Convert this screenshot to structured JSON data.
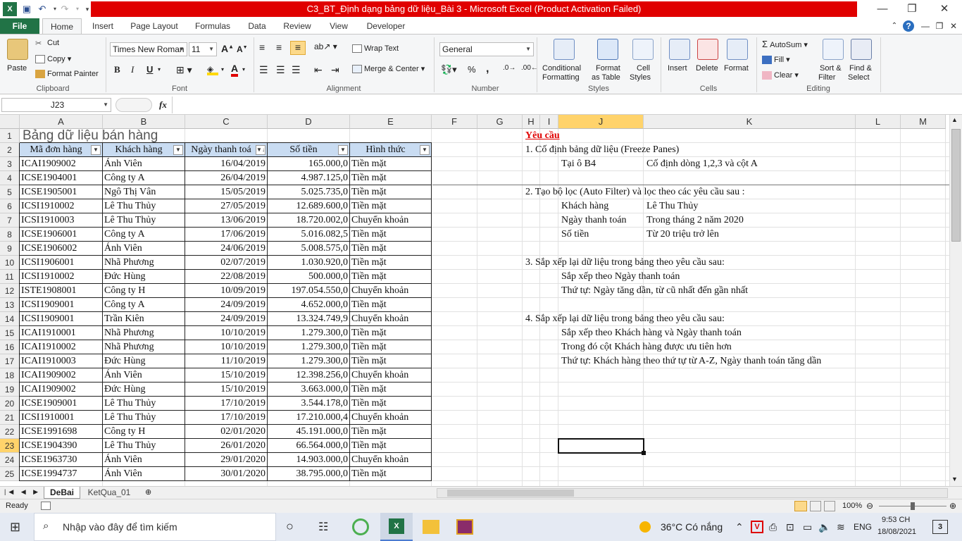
{
  "window": {
    "title": "C3_BT_Định dạng bảng dữ liệu_Bài 3  -  Microsoft Excel (Product Activation Failed)",
    "minimize": "—",
    "restore": "❐",
    "close": "✕"
  },
  "tabs": [
    "File",
    "Home",
    "Insert",
    "Page Layout",
    "Formulas",
    "Data",
    "Review",
    "View",
    "Developer"
  ],
  "ribbon": {
    "clipboard": {
      "paste": "Paste",
      "cut": "Cut",
      "copy": "Copy",
      "format_painter": "Format Painter",
      "label": "Clipboard"
    },
    "font": {
      "name": "Times New Roman",
      "size": "11",
      "bold": "B",
      "italic": "I",
      "underline": "U",
      "label": "Font"
    },
    "alignment": {
      "wrap": "Wrap Text",
      "merge": "Merge & Center",
      "label": "Alignment"
    },
    "number": {
      "format": "General",
      "percent": "%",
      "comma": ",",
      "label": "Number"
    },
    "styles": {
      "conditional": "Conditional",
      "conditional2": "Formatting",
      "format_table": "Format",
      "format_table2": "as Table",
      "cell_styles": "Cell",
      "cell_styles2": "Styles",
      "label": "Styles"
    },
    "cells": {
      "insert": "Insert",
      "delete": "Delete",
      "format": "Format",
      "label": "Cells"
    },
    "editing": {
      "autosum": "AutoSum",
      "fill": "Fill",
      "clear": "Clear",
      "sort": "Sort &",
      "sort2": "Filter",
      "find": "Find &",
      "find2": "Select",
      "label": "Editing"
    }
  },
  "formula_bar": {
    "name_box": "J23",
    "fx": "fx",
    "value": ""
  },
  "columns": [
    "A",
    "B",
    "C",
    "D",
    "E",
    "F",
    "G",
    "H",
    "I",
    "J",
    "K",
    "L",
    "M"
  ],
  "rows": [
    "1",
    "2",
    "3",
    "4",
    "5",
    "6",
    "7",
    "8",
    "9",
    "10",
    "11",
    "12",
    "13",
    "14",
    "15",
    "16",
    "17",
    "18",
    "19",
    "20",
    "21",
    "22",
    "23",
    "24",
    "25"
  ],
  "sheet_title": "Bảng dữ liệu bán hàng",
  "table_headers": [
    "Mã đơn hàng",
    "Khách hàng",
    "Ngày thanh toá",
    "Số tiền",
    "Hình thức"
  ],
  "table_rows": [
    [
      "ICAI1909002",
      "Ánh Viên",
      "16/04/2019",
      "165.000,0",
      "Tiền mặt"
    ],
    [
      "ICSE1904001",
      "Công ty A",
      "26/04/2019",
      "4.987.125,0",
      "Tiền mặt"
    ],
    [
      "ICSE1905001",
      "Ngô Thị Vân",
      "15/05/2019",
      "5.025.735,0",
      "Tiền mặt"
    ],
    [
      "ICSI1910002",
      "Lê Thu Thủy",
      "27/05/2019",
      "12.689.600,0",
      "Tiền mặt"
    ],
    [
      "ICSI1910003",
      "Lê Thu Thủy",
      "13/06/2019",
      "18.720.002,0",
      "Chuyển khoản"
    ],
    [
      "ICSE1906001",
      "Công ty A",
      "17/06/2019",
      "5.016.082,5",
      "Tiền mặt"
    ],
    [
      "ICSE1906002",
      "Ánh Viên",
      "24/06/2019",
      "5.008.575,0",
      "Tiền mặt"
    ],
    [
      "ICSI1906001",
      "Nhã Phương",
      "02/07/2019",
      "1.030.920,0",
      "Tiền mặt"
    ],
    [
      "ICSI1910002",
      "Đức Hùng",
      "22/08/2019",
      "500.000,0",
      "Tiền mặt"
    ],
    [
      "ISTE1908001",
      "Công ty H",
      "10/09/2019",
      "197.054.550,0",
      "Chuyển khoản"
    ],
    [
      "ICSI1909001",
      "Công ty A",
      "24/09/2019",
      "4.652.000,0",
      "Tiền mặt"
    ],
    [
      "ICSI1909001",
      "Trần Kiên",
      "24/09/2019",
      "13.324.749,9",
      "Chuyển khoản"
    ],
    [
      "ICAI1910001",
      "Nhã Phương",
      "10/10/2019",
      "1.279.300,0",
      "Tiền mặt"
    ],
    [
      "ICAI1910002",
      "Nhã Phương",
      "10/10/2019",
      "1.279.300,0",
      "Tiền mặt"
    ],
    [
      "ICAI1910003",
      "Đức Hùng",
      "11/10/2019",
      "1.279.300,0",
      "Tiền mặt"
    ],
    [
      "ICAI1909002",
      "Ánh Viên",
      "15/10/2019",
      "12.398.256,0",
      "Chuyển khoản"
    ],
    [
      "ICAI1909002",
      "Đức Hùng",
      "15/10/2019",
      "3.663.000,0",
      "Tiền mặt"
    ],
    [
      "ICSE1909001",
      "Lê Thu Thủy",
      "17/10/2019",
      "3.544.178,0",
      "Tiền mặt"
    ],
    [
      "ICSI1910001",
      "Lê Thu Thủy",
      "17/10/2019",
      "17.210.000,4",
      "Chuyển khoản"
    ],
    [
      "ICSE1991698",
      "Công ty H",
      "02/01/2020",
      "45.191.000,0",
      "Tiền mặt"
    ],
    [
      "ICSE1904390",
      "Lê Thu Thủy",
      "26/01/2020",
      "66.564.000,0",
      "Tiền mặt"
    ],
    [
      "ICSE1963730",
      "Ánh Viên",
      "29/01/2020",
      "14.903.000,0",
      "Chuyển khoản"
    ],
    [
      "ICSE1994737",
      "Ánh Viên",
      "30/01/2020",
      "38.795.000,0",
      "Tiền mặt"
    ]
  ],
  "requirements": {
    "heading": "Yêu cầu",
    "lines": [
      {
        "row": 2,
        "col": "H",
        "text": "1. Cố định bảng dữ liệu (Freeze Panes)"
      },
      {
        "row": 3,
        "col": "J",
        "text": "Tại ô B4"
      },
      {
        "row": 3,
        "col": "K",
        "text": "Cố định dòng 1,2,3 và cột A"
      },
      {
        "row": 5,
        "col": "H",
        "text": "2. Tạo bộ lọc (Auto Filter) và lọc theo các yêu cầu sau :"
      },
      {
        "row": 6,
        "col": "J",
        "text": "Khách hàng"
      },
      {
        "row": 6,
        "col": "K",
        "text": "Lê Thu Thủy"
      },
      {
        "row": 7,
        "col": "J",
        "text": "Ngày thanh toán"
      },
      {
        "row": 7,
        "col": "K",
        "text": "Trong tháng 2 năm 2020"
      },
      {
        "row": 8,
        "col": "J",
        "text": "Số tiền"
      },
      {
        "row": 8,
        "col": "K",
        "text": "Từ 20 triệu trở lên"
      },
      {
        "row": 10,
        "col": "H",
        "text": "3. Sắp xếp lại dữ liệu trong bảng theo yêu cầu sau:"
      },
      {
        "row": 11,
        "col": "J",
        "text": "Sắp xếp theo Ngày thanh toán"
      },
      {
        "row": 12,
        "col": "J",
        "text": "Thứ tự: Ngày tăng dần, từ cũ nhất đến gần nhất"
      },
      {
        "row": 14,
        "col": "H",
        "text": "4. Sắp xếp lại dữ liệu trong bảng theo yêu cầu sau:"
      },
      {
        "row": 15,
        "col": "J",
        "text": "Sắp xếp theo Khách hàng và Ngày thanh toán"
      },
      {
        "row": 16,
        "col": "J",
        "text": "Trong đó cột Khách hàng được ưu tiên hơn"
      },
      {
        "row": 17,
        "col": "J",
        "text": "Thứ tự: Khách hàng theo thứ tự từ A-Z, Ngày thanh toán tăng dần"
      }
    ]
  },
  "sheets": [
    "DeBai",
    "KetQua_01"
  ],
  "status": {
    "ready": "Ready",
    "zoom": "100%"
  },
  "taskbar": {
    "search_placeholder": "Nhập vào đây để tìm kiếm",
    "weather": "36°C  Có nắng",
    "lang": "ENG",
    "time": "9:53 CH",
    "date": "18/08/2021",
    "notifications": "3"
  },
  "colors": {
    "excel_green": "#217346",
    "title_red": "#e00000",
    "selected_header": "#ffd36b",
    "heading_red": "#e00000"
  }
}
